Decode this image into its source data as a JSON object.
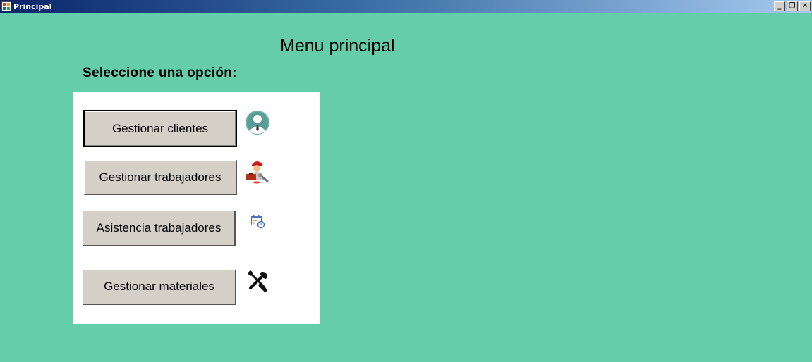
{
  "window": {
    "title": "Principal",
    "controls": {
      "minimize": "_",
      "restore": "❐",
      "close": "✕"
    }
  },
  "main": {
    "title": "Menu principal",
    "subtitle": "Seleccione una opción:"
  },
  "menu": {
    "items": [
      {
        "label": "Gestionar clientes",
        "icon": "client-icon"
      },
      {
        "label": "Gestionar trabajadores",
        "icon": "worker-icon"
      },
      {
        "label": "Asistencia trabajadores",
        "icon": "calendar-icon"
      },
      {
        "label": "Gestionar materiales",
        "icon": "tools-icon"
      }
    ]
  },
  "colors": {
    "background": "#66cdaa",
    "panel": "#ffffff",
    "button": "#d4d0c8"
  }
}
